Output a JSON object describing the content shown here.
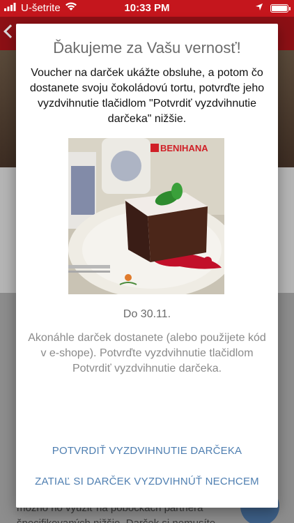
{
  "status_bar": {
    "carrier": "U-šetrite",
    "time": "10:33 PM"
  },
  "dialog": {
    "title": "Ďakujeme za Vašu vernosť!",
    "intro": "Voucher na darček ukážte obsluhe, a potom čo dostanete svoju čokoládovú tortu, potvrďte jeho vyzdvihnutie tlačidlom \"Potvrdiť vyzdvihnutie darčeka\" nižšie.",
    "image_brand": "BENIHANA",
    "validity": "Do 30.11.",
    "info": "Akonáhle darček dostanete (alebo použijete kód v e-shope). Potvrďte vyzdvihnutie tlačidlom Potvrdiť vyzdvihnutie darčeka.",
    "confirm_button": "POTVRDIŤ VYZDVIHNUTIE DARČEKA",
    "decline_button": "ZATIAĽ SI DARČEK VYZDVIHNÚŤ NECHCEM"
  },
  "background": {
    "body_text": "možno no využiť na pobočkách partnera špecifikovaných nižšie. Darček si nemusíte"
  },
  "colors": {
    "status_bar": "#c5161d",
    "dialog_button": "#4f7fb1",
    "brand_red": "#d01f26"
  }
}
